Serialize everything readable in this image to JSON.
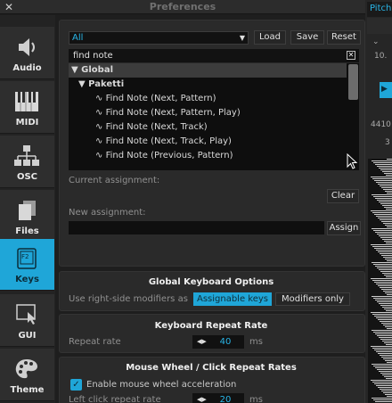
{
  "window": {
    "title": "Preferences"
  },
  "background_app": {
    "pitch_label": "Pitch",
    "value_10": "10.",
    "value_4410": "4410",
    "value_3": "3"
  },
  "sidebar": {
    "items": [
      {
        "label": "Audio",
        "icon": "speaker-icon"
      },
      {
        "label": "MIDI",
        "icon": "piano-keys-icon"
      },
      {
        "label": "OSC",
        "icon": "network-icon"
      },
      {
        "label": "Files",
        "icon": "files-icon"
      },
      {
        "label": "Keys",
        "icon": "keyboard-key-icon",
        "key_caption": "F2",
        "active": true
      },
      {
        "label": "GUI",
        "icon": "gui-pointer-icon"
      },
      {
        "label": "Theme",
        "icon": "palette-icon"
      }
    ]
  },
  "keys": {
    "filter_value": "All",
    "load_label": "Load",
    "save_label": "Save",
    "reset_label": "Reset",
    "search_value": "find note",
    "tree": {
      "group": "Global",
      "subgroup": "Paketti",
      "items": [
        "Find Note (Next, Pattern)",
        "Find Note (Next, Pattern, Play)",
        "Find Note (Next, Track)",
        "Find Note (Next, Track, Play)",
        "Find Note (Previous, Pattern)"
      ]
    },
    "current_assignment_label": "Current assignment:",
    "clear_label": "Clear",
    "new_assignment_label": "New assignment:",
    "assign_label": "Assign"
  },
  "global_keyboard_options": {
    "title": "Global Keyboard Options",
    "modifiers_label": "Use right-side modifiers as",
    "options": [
      "Assignable keys",
      "Modifiers only"
    ],
    "selected": "Assignable keys"
  },
  "keyboard_repeat_rate": {
    "title": "Keyboard Repeat Rate",
    "label": "Repeat rate",
    "value": "40",
    "unit": "ms"
  },
  "mouse_wheel": {
    "title": "Mouse Wheel / Click Repeat Rates",
    "accel_label": "Enable mouse wheel acceleration",
    "accel_checked": true,
    "left_click_label": "Left click repeat rate",
    "left_click_value": "20",
    "unit": "ms"
  },
  "colors": {
    "accent": "#1fa6d8",
    "panel": "#2a2a2a",
    "background": "#1e1e1e"
  }
}
